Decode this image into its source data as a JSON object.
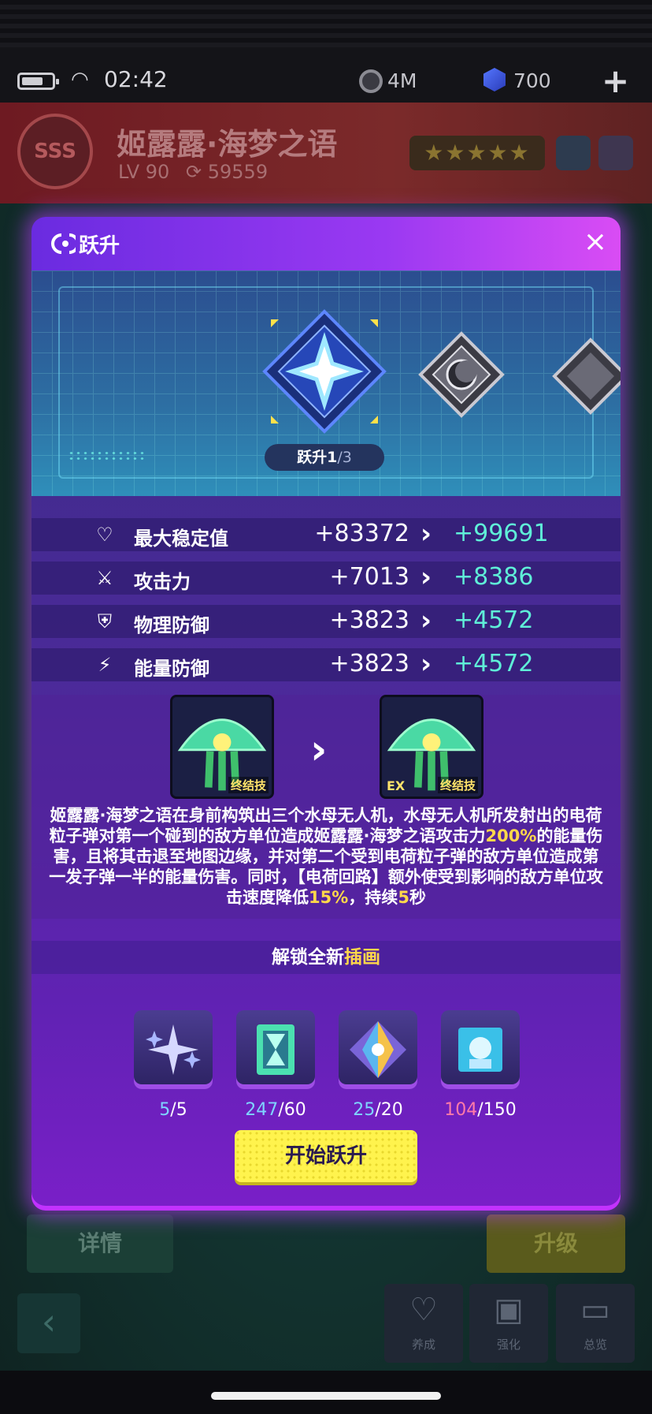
{
  "status": {
    "time": "02:42",
    "coins": "4M",
    "gems": "700"
  },
  "hero": {
    "name": "姬露露·海梦之语",
    "level": "LV 90",
    "power": "59559",
    "rank_badge": "SSS",
    "stars": "★★★★★"
  },
  "modal": {
    "title": "跃升",
    "close_label": "×",
    "stage": {
      "label": "跃升",
      "current": "1",
      "total": "/3"
    },
    "stats": [
      {
        "icon": "heart-pulse-icon",
        "label": "最大稳定值",
        "old": "+83372",
        "new": "+99691"
      },
      {
        "icon": "sword-icon",
        "label": "攻击力",
        "old": "+7013",
        "new": "+8386"
      },
      {
        "icon": "shield-exclaim-icon",
        "label": "物理防御",
        "old": "+3823",
        "new": "+4572"
      },
      {
        "icon": "shield-bolt-icon",
        "label": "能量防御",
        "old": "+3823",
        "new": "+4572"
      }
    ],
    "skill": {
      "tag": "终结技",
      "ex_tag": "EX",
      "desc_parts": [
        "姬露露·海梦之语在身前构筑出三个水母无人机，水母无人机所发射出的电荷粒子弹对第一个碰到的敌方单位造成姬露露·海梦之语攻击力",
        "200%",
        "的能量伤害，且将其击退至地图边缘，并对第二个受到电荷粒子弹的敌方单位造成第一发子弹一半的能量伤害。同时，【电荷回路】额外使受到影响的敌方单位攻击速度降低",
        "15%",
        "，持续",
        "5",
        "秒"
      ]
    },
    "unlock": {
      "prefix": "解锁全新",
      "highlight": "插画"
    },
    "materials": [
      {
        "icon": "star-sparkle-icon",
        "have": "5",
        "need": "/5",
        "ok": true
      },
      {
        "icon": "hourglass-chip-icon",
        "have": "247",
        "need": "/60",
        "ok": true
      },
      {
        "icon": "prism-crystal-icon",
        "have": "25",
        "need": "/20",
        "ok": true
      },
      {
        "icon": "character-card-icon",
        "have": "104",
        "need": "/150",
        "ok": false
      }
    ],
    "start_button": "开始跃升"
  },
  "background": {
    "details_button": "详情",
    "upgrade_button": "升级",
    "nav": [
      {
        "label": "养成",
        "icon": "heart-icon"
      },
      {
        "label": "强化",
        "icon": "chip-upgrade-icon"
      },
      {
        "label": "总览",
        "icon": "folder-icon"
      }
    ]
  },
  "colors": {
    "accent_new_value": "#5ff0d8",
    "highlight": "#ffd84a",
    "button_yellow": "#fff34d",
    "modal_purple": "#6122b4"
  }
}
